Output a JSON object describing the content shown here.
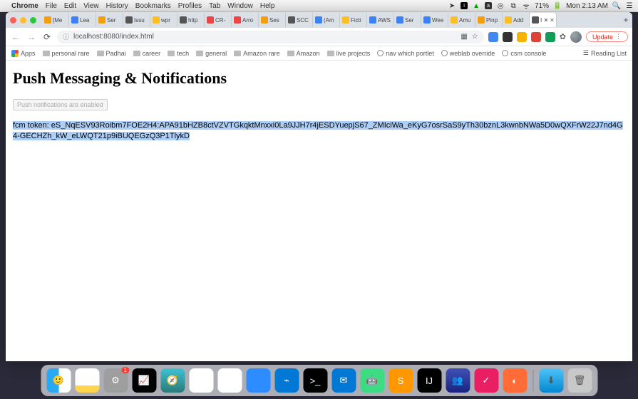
{
  "menubar": {
    "app": "Chrome",
    "items": [
      "File",
      "Edit",
      "View",
      "History",
      "Bookmarks",
      "Profiles",
      "Tab",
      "Window",
      "Help"
    ],
    "battery": "71%",
    "clock": "Mon 2:13 AM"
  },
  "tabs": [
    {
      "label": "[Me",
      "fav": "fv-o"
    },
    {
      "label": "Lea",
      "fav": "fv-w"
    },
    {
      "label": "Ser",
      "fav": "fv-o"
    },
    {
      "label": "Issu",
      "fav": "fv-g"
    },
    {
      "label": "wpr",
      "fav": "fv-y"
    },
    {
      "label": "http",
      "fav": "fv-g"
    },
    {
      "label": "CR-",
      "fav": "fv-r"
    },
    {
      "label": "Arro",
      "fav": "fv-r"
    },
    {
      "label": "Ses",
      "fav": "fv-o"
    },
    {
      "label": "SCC",
      "fav": "fv-g"
    },
    {
      "label": "(Am",
      "fav": "fv-w"
    },
    {
      "label": "Ficti",
      "fav": "fv-y"
    },
    {
      "label": "AWS",
      "fav": "fv-w"
    },
    {
      "label": "Ser",
      "fav": "fv-w"
    },
    {
      "label": "Wee",
      "fav": "fv-w"
    },
    {
      "label": "Amu",
      "fav": "fv-y"
    },
    {
      "label": "Pinp",
      "fav": "fv-o"
    },
    {
      "label": "Add",
      "fav": "fv-y"
    },
    {
      "label": "I ✕",
      "fav": "fv-g",
      "active": true
    }
  ],
  "new_tab": "+",
  "addr": {
    "url": "localhost:8080/index.html",
    "info_icon": "ⓘ",
    "update": "Update",
    "update_menu": "⋮",
    "star": "☆",
    "qr": "▦"
  },
  "bookmarks": [
    {
      "type": "apps",
      "label": "Apps"
    },
    {
      "type": "folder",
      "label": "personal rare"
    },
    {
      "type": "folder",
      "label": "Padhai"
    },
    {
      "type": "folder",
      "label": "career"
    },
    {
      "type": "folder",
      "label": "tech"
    },
    {
      "type": "folder",
      "label": "general"
    },
    {
      "type": "folder",
      "label": "Amazon rare"
    },
    {
      "type": "folder",
      "label": "Amazon"
    },
    {
      "type": "folder",
      "label": "live projects"
    },
    {
      "type": "globe",
      "label": "nav which portlet"
    },
    {
      "type": "globe",
      "label": "weblab override"
    },
    {
      "type": "globe",
      "label": "csm console"
    }
  ],
  "reading_list": "Reading List",
  "page": {
    "heading": "Push Messaging & Notifications",
    "button": "Push notifications are enabled",
    "token_label": "fcm token: ",
    "token_value": "eS_NqESV93Roibm7FOE2H4:APA91bHZB8ctVZVTGkqktMnxxi0La9JJH7r4jESDYuepjS67_ZMIciWa_eKyG7osrSaS9yTh30bznL3kwnbNWa5D0wQXFrW22J7nd4G4-GECHZh_kW_eLWQT21p9iBUQEGzQ3P1TlykD"
  },
  "dock": {
    "badge": "1",
    "items": [
      {
        "name": "finder",
        "cls": "di-finder",
        "glyph": "🙂"
      },
      {
        "name": "notes",
        "cls": "di-notes",
        "glyph": ""
      },
      {
        "name": "settings",
        "cls": "di-settings",
        "glyph": "⚙",
        "badge": true
      },
      {
        "name": "activity",
        "cls": "di-act",
        "glyph": "📈"
      },
      {
        "name": "safari",
        "cls": "di-sf",
        "glyph": "🧭"
      },
      {
        "name": "chrome",
        "cls": "di-chrome",
        "glyph": "◎"
      },
      {
        "name": "slack",
        "cls": "di-slack",
        "glyph": "✱"
      },
      {
        "name": "zoom",
        "cls": "di-zoom",
        "glyph": ""
      },
      {
        "name": "vscode",
        "cls": "di-vs",
        "glyph": "⌁"
      },
      {
        "name": "terminal",
        "cls": "di-term",
        "glyph": ">_"
      },
      {
        "name": "outlook",
        "cls": "di-out",
        "glyph": "✉"
      },
      {
        "name": "android",
        "cls": "di-and",
        "glyph": "🤖"
      },
      {
        "name": "sublime",
        "cls": "di-sub",
        "glyph": "S"
      },
      {
        "name": "intellij",
        "cls": "di-ij",
        "glyph": "IJ"
      },
      {
        "name": "teams",
        "cls": "di-tm",
        "glyph": "👥"
      },
      {
        "name": "todo",
        "cls": "di-td",
        "glyph": "✓"
      },
      {
        "name": "postman",
        "cls": "di-pm",
        "glyph": "◐"
      }
    ],
    "after_sep": [
      {
        "name": "downloads",
        "cls": "di-dl",
        "glyph": "⬇"
      },
      {
        "name": "trash",
        "cls": "di-trash",
        "glyph": "🗑"
      }
    ]
  }
}
